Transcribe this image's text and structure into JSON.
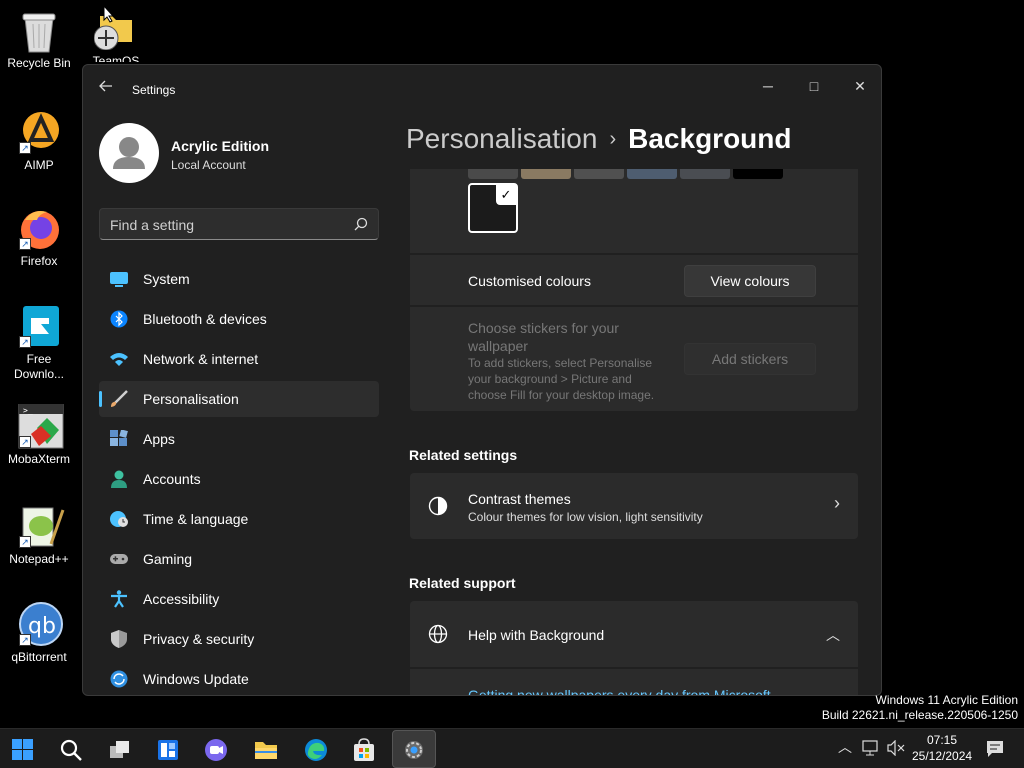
{
  "desktop": {
    "icons": [
      {
        "label": "Recycle Bin"
      },
      {
        "label": "TeamOS"
      },
      {
        "label": "AIMP"
      },
      {
        "label": "Firefox"
      },
      {
        "label": "Free Downlo..."
      },
      {
        "label": "MobaXterm"
      },
      {
        "label": "Notepad++"
      },
      {
        "label": "qBittorrent"
      }
    ]
  },
  "window": {
    "title": "Settings",
    "back_icon": "arrow-left-icon",
    "controls": {
      "minimize": "─",
      "maximize": "□",
      "close": "✕"
    }
  },
  "profile": {
    "name": "Acrylic Edition",
    "account": "Local Account"
  },
  "search": {
    "placeholder": "Find a setting"
  },
  "nav": {
    "items": [
      {
        "label": "System",
        "icon": "monitor-icon",
        "color": "#4cc2ff"
      },
      {
        "label": "Bluetooth & devices",
        "icon": "bluetooth-icon",
        "color": "#0a84ff"
      },
      {
        "label": "Network & internet",
        "icon": "wifi-icon",
        "color": "#4cc2ff"
      },
      {
        "label": "Personalisation",
        "icon": "brush-icon",
        "color": "#e8a86b",
        "active": true
      },
      {
        "label": "Apps",
        "icon": "apps-icon",
        "color": "#8ab4e0"
      },
      {
        "label": "Accounts",
        "icon": "person-icon",
        "color": "#3ec1a0"
      },
      {
        "label": "Time & language",
        "icon": "globe-clock-icon",
        "color": "#4cc2ff"
      },
      {
        "label": "Gaming",
        "icon": "gamepad-icon",
        "color": "#aaaaaa"
      },
      {
        "label": "Accessibility",
        "icon": "accessibility-icon",
        "color": "#4cc2ff"
      },
      {
        "label": "Privacy & security",
        "icon": "shield-icon",
        "color": "#9a9a9a"
      },
      {
        "label": "Windows Update",
        "icon": "update-icon",
        "color": "#2f8fe0"
      }
    ]
  },
  "content": {
    "breadcrumb": {
      "parent": "Personalisation",
      "separator": "›",
      "current": "Background"
    },
    "swatches": [
      "#4a4a4a",
      "#8a7a62",
      "#505050",
      "#4e5d70",
      "#4a4d52",
      "#000000"
    ],
    "selected_swatch_check": "✓",
    "custom_colours": {
      "label": "Customised colours",
      "button": "View colours"
    },
    "stickers": {
      "title": "Choose stickers for your wallpaper",
      "description": "To add stickers, select Personalise your background > Picture and choose Fill for your desktop image.",
      "button": "Add stickers"
    },
    "related_settings": {
      "title": "Related settings",
      "contrast": {
        "title": "Contrast themes",
        "subtitle": "Colour themes for low vision, light sensitivity",
        "chevron": "›"
      }
    },
    "related_support": {
      "title": "Related support",
      "help": {
        "title": "Help with Background",
        "chevron": "︿"
      },
      "link": "Getting new wallpapers every day from Microsoft"
    }
  },
  "watermark": {
    "line1": "Windows 11 Acrylic Edition",
    "line2": "Build 22621.ni_release.220506-1250"
  },
  "taskbar": {
    "icons": [
      "windows-start-icon",
      "search-icon",
      "task-view-icon",
      "widgets-icon",
      "teams-chat-icon",
      "file-explorer-icon",
      "edge-icon",
      "store-icon",
      "settings-icon"
    ],
    "tray_chevron": "︿",
    "time": "07:15",
    "date": "25/12/2024"
  }
}
